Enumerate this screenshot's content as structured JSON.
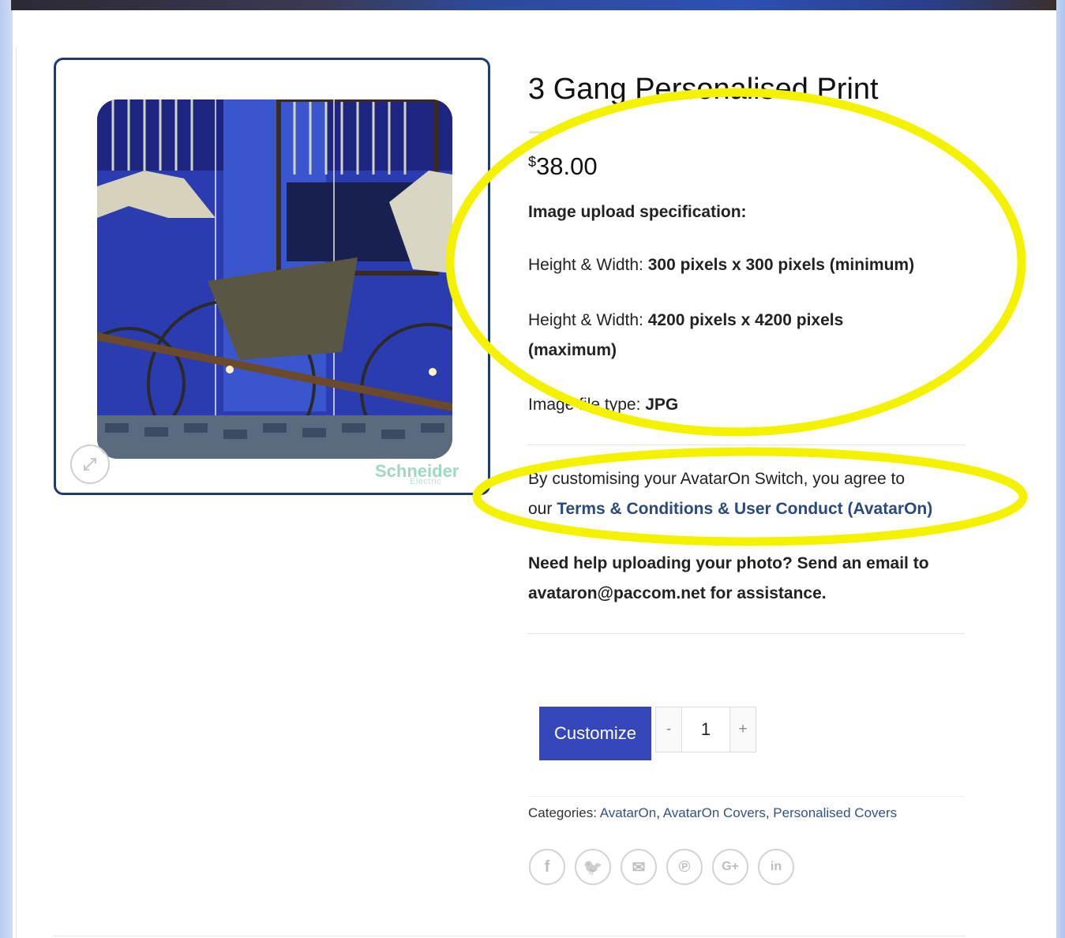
{
  "product": {
    "title": "3 Gang Personalised Print",
    "currency": "$",
    "price": "38.00",
    "spec_heading": "Image upload specification:",
    "spec_min_label": "Height & Width:",
    "spec_min_value": "300 pixels x 300 pixels (minimum)",
    "spec_max_label": "Height & Width:",
    "spec_max_value_line1": "4200 pixels x 4200 pixels",
    "spec_max_value_line2": "(maximum)",
    "file_type_label": "Image file type:",
    "file_type_value": "JPG",
    "terms_line1": "By customising your AvatarOn Switch, you agree to",
    "terms_prefix": "our",
    "terms_link": "Terms & Conditions & User Conduct (AvatarOn)",
    "help_line1": "Need help uploading your photo? Send an email to",
    "help_line2": "avataron@paccom.net for assistance."
  },
  "gallery": {
    "logo_text": "Schneider",
    "logo_subtext": "Electric",
    "zoom_icon": "expand-icon"
  },
  "cart": {
    "button_label": "Customize",
    "qty_minus": "-",
    "qty_value": "1",
    "qty_plus": "+"
  },
  "meta": {
    "categories_label": "Categories:",
    "categories": [
      "AvatarOn",
      "AvatarOn Covers",
      "Personalised Covers"
    ]
  },
  "share": {
    "icons": [
      "facebook-icon",
      "twitter-icon",
      "email-icon",
      "pinterest-icon",
      "google-plus-icon",
      "linkedin-icon"
    ],
    "glyphs": [
      "f",
      "🐦",
      "✉",
      "℗",
      "G+",
      "in"
    ]
  },
  "colors": {
    "accent": "#3547b8",
    "gallery_border": "#1e3d6e",
    "link": "#2a4a7a",
    "highlight": "#f5f200"
  }
}
